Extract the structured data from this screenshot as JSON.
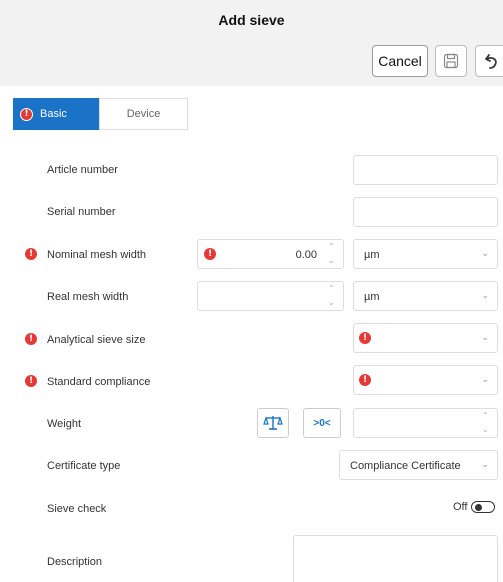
{
  "header": {
    "title": "Add sieve",
    "cancel_label": "Cancel",
    "save_icon": "save-icon",
    "undo_icon": "undo-icon"
  },
  "tabs": [
    {
      "label": "Basic",
      "active": true,
      "has_error": true
    },
    {
      "label": "Device",
      "active": false,
      "has_error": false
    }
  ],
  "form": {
    "article_number": {
      "label": "Article number",
      "value": ""
    },
    "serial_number": {
      "label": "Serial number",
      "value": ""
    },
    "nominal_mesh_width": {
      "label": "Nominal mesh width",
      "value": "0.00",
      "unit": "µm",
      "has_error": true
    },
    "real_mesh_width": {
      "label": "Real mesh width",
      "value": "",
      "unit": "µm"
    },
    "analytical_sieve_size": {
      "label": "Analytical sieve size",
      "value": "",
      "has_error": true
    },
    "standard_compliance": {
      "label": "Standard compliance",
      "value": "",
      "has_error": true
    },
    "weight": {
      "label": "Weight",
      "value": "",
      "tare_label": ">0<",
      "scale_icon": "scale-icon"
    },
    "certificate_type": {
      "label": "Certificate type",
      "value": "Compliance Certificate"
    },
    "sieve_check": {
      "label": "Sieve check",
      "state": "Off"
    },
    "description": {
      "label": "Description",
      "value": ""
    }
  },
  "colors": {
    "accent": "#1a73c7",
    "error": "#e53935",
    "header_bg": "#f2f2f2"
  }
}
